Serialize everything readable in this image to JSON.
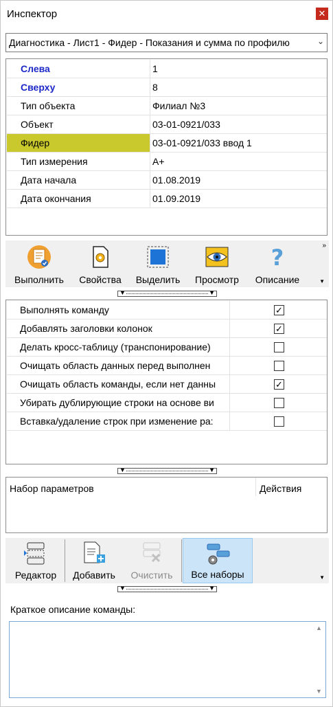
{
  "window": {
    "title": "Инспектор",
    "close_glyph": "✕"
  },
  "dropdown": {
    "value": "Диагностика - Лист1 - Фидер - Показания и сумма по профилю",
    "arrow": "⌄"
  },
  "properties": [
    {
      "key": "Слева",
      "value": "1"
    },
    {
      "key": "Сверху",
      "value": "8"
    },
    {
      "key": "Тип объекта",
      "value": "Филиал №3"
    },
    {
      "key": "Объект",
      "value": "03-01-0921/033"
    },
    {
      "key": "Фидер",
      "value": "03-01-0921/033 ввод 1"
    },
    {
      "key": "Тип измерения",
      "value": "A+"
    },
    {
      "key": "Дата начала",
      "value": "01.08.2019"
    },
    {
      "key": "Дата окончания",
      "value": "01.09.2019"
    }
  ],
  "toolbar": {
    "more_glyph": "»",
    "drop_glyph": "▼",
    "buttons": [
      {
        "label": "Выполнить",
        "icon": "execute-icon"
      },
      {
        "label": "Свойства",
        "icon": "properties-icon"
      },
      {
        "label": "Выделить",
        "icon": "select-icon"
      },
      {
        "label": "Просмотр",
        "icon": "eye-icon"
      },
      {
        "label": "Описание",
        "icon": "help-icon"
      }
    ]
  },
  "splitter_glyph": "▼",
  "settings": [
    {
      "label": "Выполнять команду",
      "checked": true
    },
    {
      "label": "Добавлять заголовки колонок",
      "checked": true
    },
    {
      "label": "Делать кросс-таблицу (транспонирование)",
      "checked": false
    },
    {
      "label": "Очищать область данных  перед выполнен",
      "checked": false
    },
    {
      "label": "Очищать область команды, если нет данны",
      "checked": true
    },
    {
      "label": "Убирать дублирующие строки на основе ви",
      "checked": false
    },
    {
      "label": "Вставка/удаление строк при изменение ра:",
      "checked": false
    }
  ],
  "params": {
    "col1": "Набор параметров",
    "col2": "Действия"
  },
  "toolbar2": {
    "drop_glyph": "▼",
    "buttons": [
      {
        "label": "Редактор",
        "icon": "editor-icon",
        "disabled": false,
        "selected": false
      },
      {
        "label": "Добавить",
        "icon": "add-icon",
        "disabled": false,
        "selected": false
      },
      {
        "label": "Очистить",
        "icon": "clear-icon",
        "disabled": true,
        "selected": false
      },
      {
        "label": "Все наборы",
        "icon": "all-sets-icon",
        "disabled": false,
        "selected": true
      }
    ]
  },
  "description": {
    "label": "Краткое описание команды:",
    "value": "",
    "scroll_up": "▲",
    "scroll_down": "▼"
  },
  "colors": {
    "key_bold": "#1c28c8",
    "highlight": "#c9c92e",
    "close": "#c42b1c",
    "selected_bg": "#cce4f7"
  }
}
